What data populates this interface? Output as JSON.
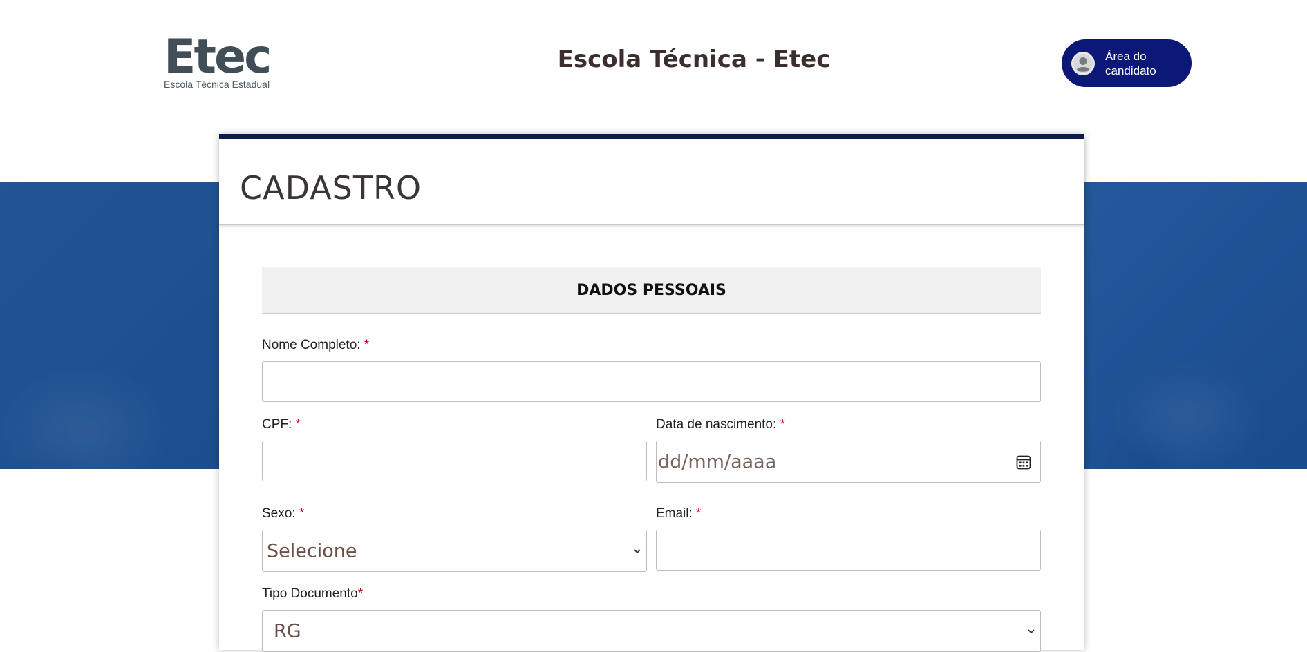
{
  "header": {
    "logo_mark": "Etec",
    "logo_sub": "Escola Técnica Estadual",
    "title": "Escola Técnica - Etec",
    "area_button_label": "Área do candidato"
  },
  "form": {
    "title": "CADASTRO",
    "section_title": "DADOS PESSOAIS",
    "required_marker": "*",
    "fields": {
      "nome": {
        "label": "Nome Completo:",
        "value": ""
      },
      "cpf": {
        "label": "CPF:",
        "value": ""
      },
      "nascimento": {
        "label": "Data de nascimento:",
        "placeholder": "dd/mm/aaaa"
      },
      "sexo": {
        "label": "Sexo:",
        "selected": "Selecione"
      },
      "email": {
        "label": "Email:",
        "value": ""
      },
      "tipo_documento": {
        "label": "Tipo Documento",
        "selected": "RG"
      }
    }
  },
  "colors": {
    "accent": "#0c1877",
    "card_border": "#0c1a4f",
    "banner": "#1f5494",
    "required": "#d0021b"
  },
  "icons": {
    "avatar": "user-avatar-icon",
    "calendar": "calendar-icon",
    "select_arrow": "chevron-down-icon"
  }
}
